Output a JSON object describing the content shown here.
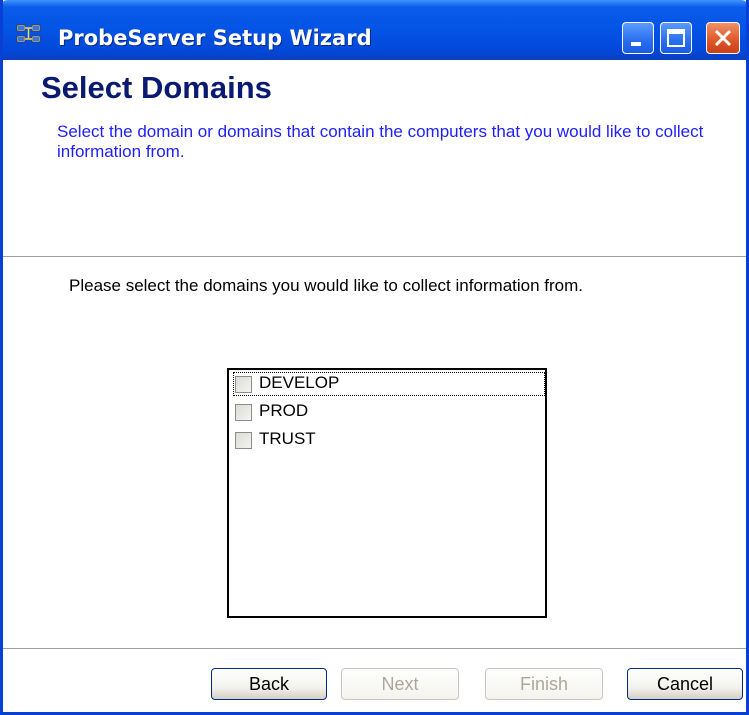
{
  "window": {
    "title": "ProbeServer Setup Wizard",
    "app_icon": "network-computers-icon",
    "controls": {
      "minimize": "minimize-icon",
      "maximize": "maximize-icon",
      "close": "close-icon"
    }
  },
  "header": {
    "heading": "Select Domains",
    "description": "Select the domain or domains that contain the computers that you would like to collect information from."
  },
  "body": {
    "instruction": "Please select the domains you would like to collect information from.",
    "domains": [
      {
        "label": "DEVELOP",
        "checked": false,
        "focused": true
      },
      {
        "label": "PROD",
        "checked": false,
        "focused": false
      },
      {
        "label": "TRUST",
        "checked": false,
        "focused": false
      }
    ]
  },
  "footer": {
    "back_label": "Back",
    "next_label": "Next",
    "finish_label": "Finish",
    "cancel_label": "Cancel",
    "next_enabled": false,
    "finish_enabled": false
  },
  "colors": {
    "title_bar": "#0453e5",
    "heading": "#0a1a70",
    "description": "#2020ff",
    "close_button": "#e05a2a",
    "disabled_text": "#aca899"
  }
}
